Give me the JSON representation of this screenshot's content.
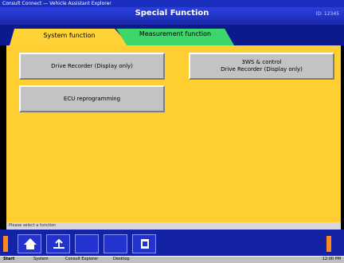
{
  "window": {
    "title": "Consult Connect — Vehicle Assistant Explorer",
    "header_title": "Special Function",
    "header_right": "ID: 12345"
  },
  "tabs": [
    {
      "label": "System function"
    },
    {
      "label": "Measurement function"
    }
  ],
  "buttons": {
    "drive_recorder": "Drive Recorder (Display only)",
    "ecu_reprogramming": "ECU reprogramming",
    "three_ws_line1": "3WS & control",
    "three_ws_line2": "Drive Recorder (Display only)"
  },
  "status": {
    "text": "Please select a function"
  },
  "toolbar": {
    "home_icon": "home-icon",
    "back_icon": "back-arrow-icon",
    "print_icon": "print-icon"
  },
  "taskbar": {
    "start": "Start",
    "items": [
      "System",
      "Consult Explorer",
      "Desktop"
    ],
    "tray": "12:00 PM"
  },
  "colors": {
    "header": "#1a2aa8",
    "tab_system": "#ffd235",
    "tab_measure": "#3cd66a",
    "panel": "#ffcf32"
  }
}
